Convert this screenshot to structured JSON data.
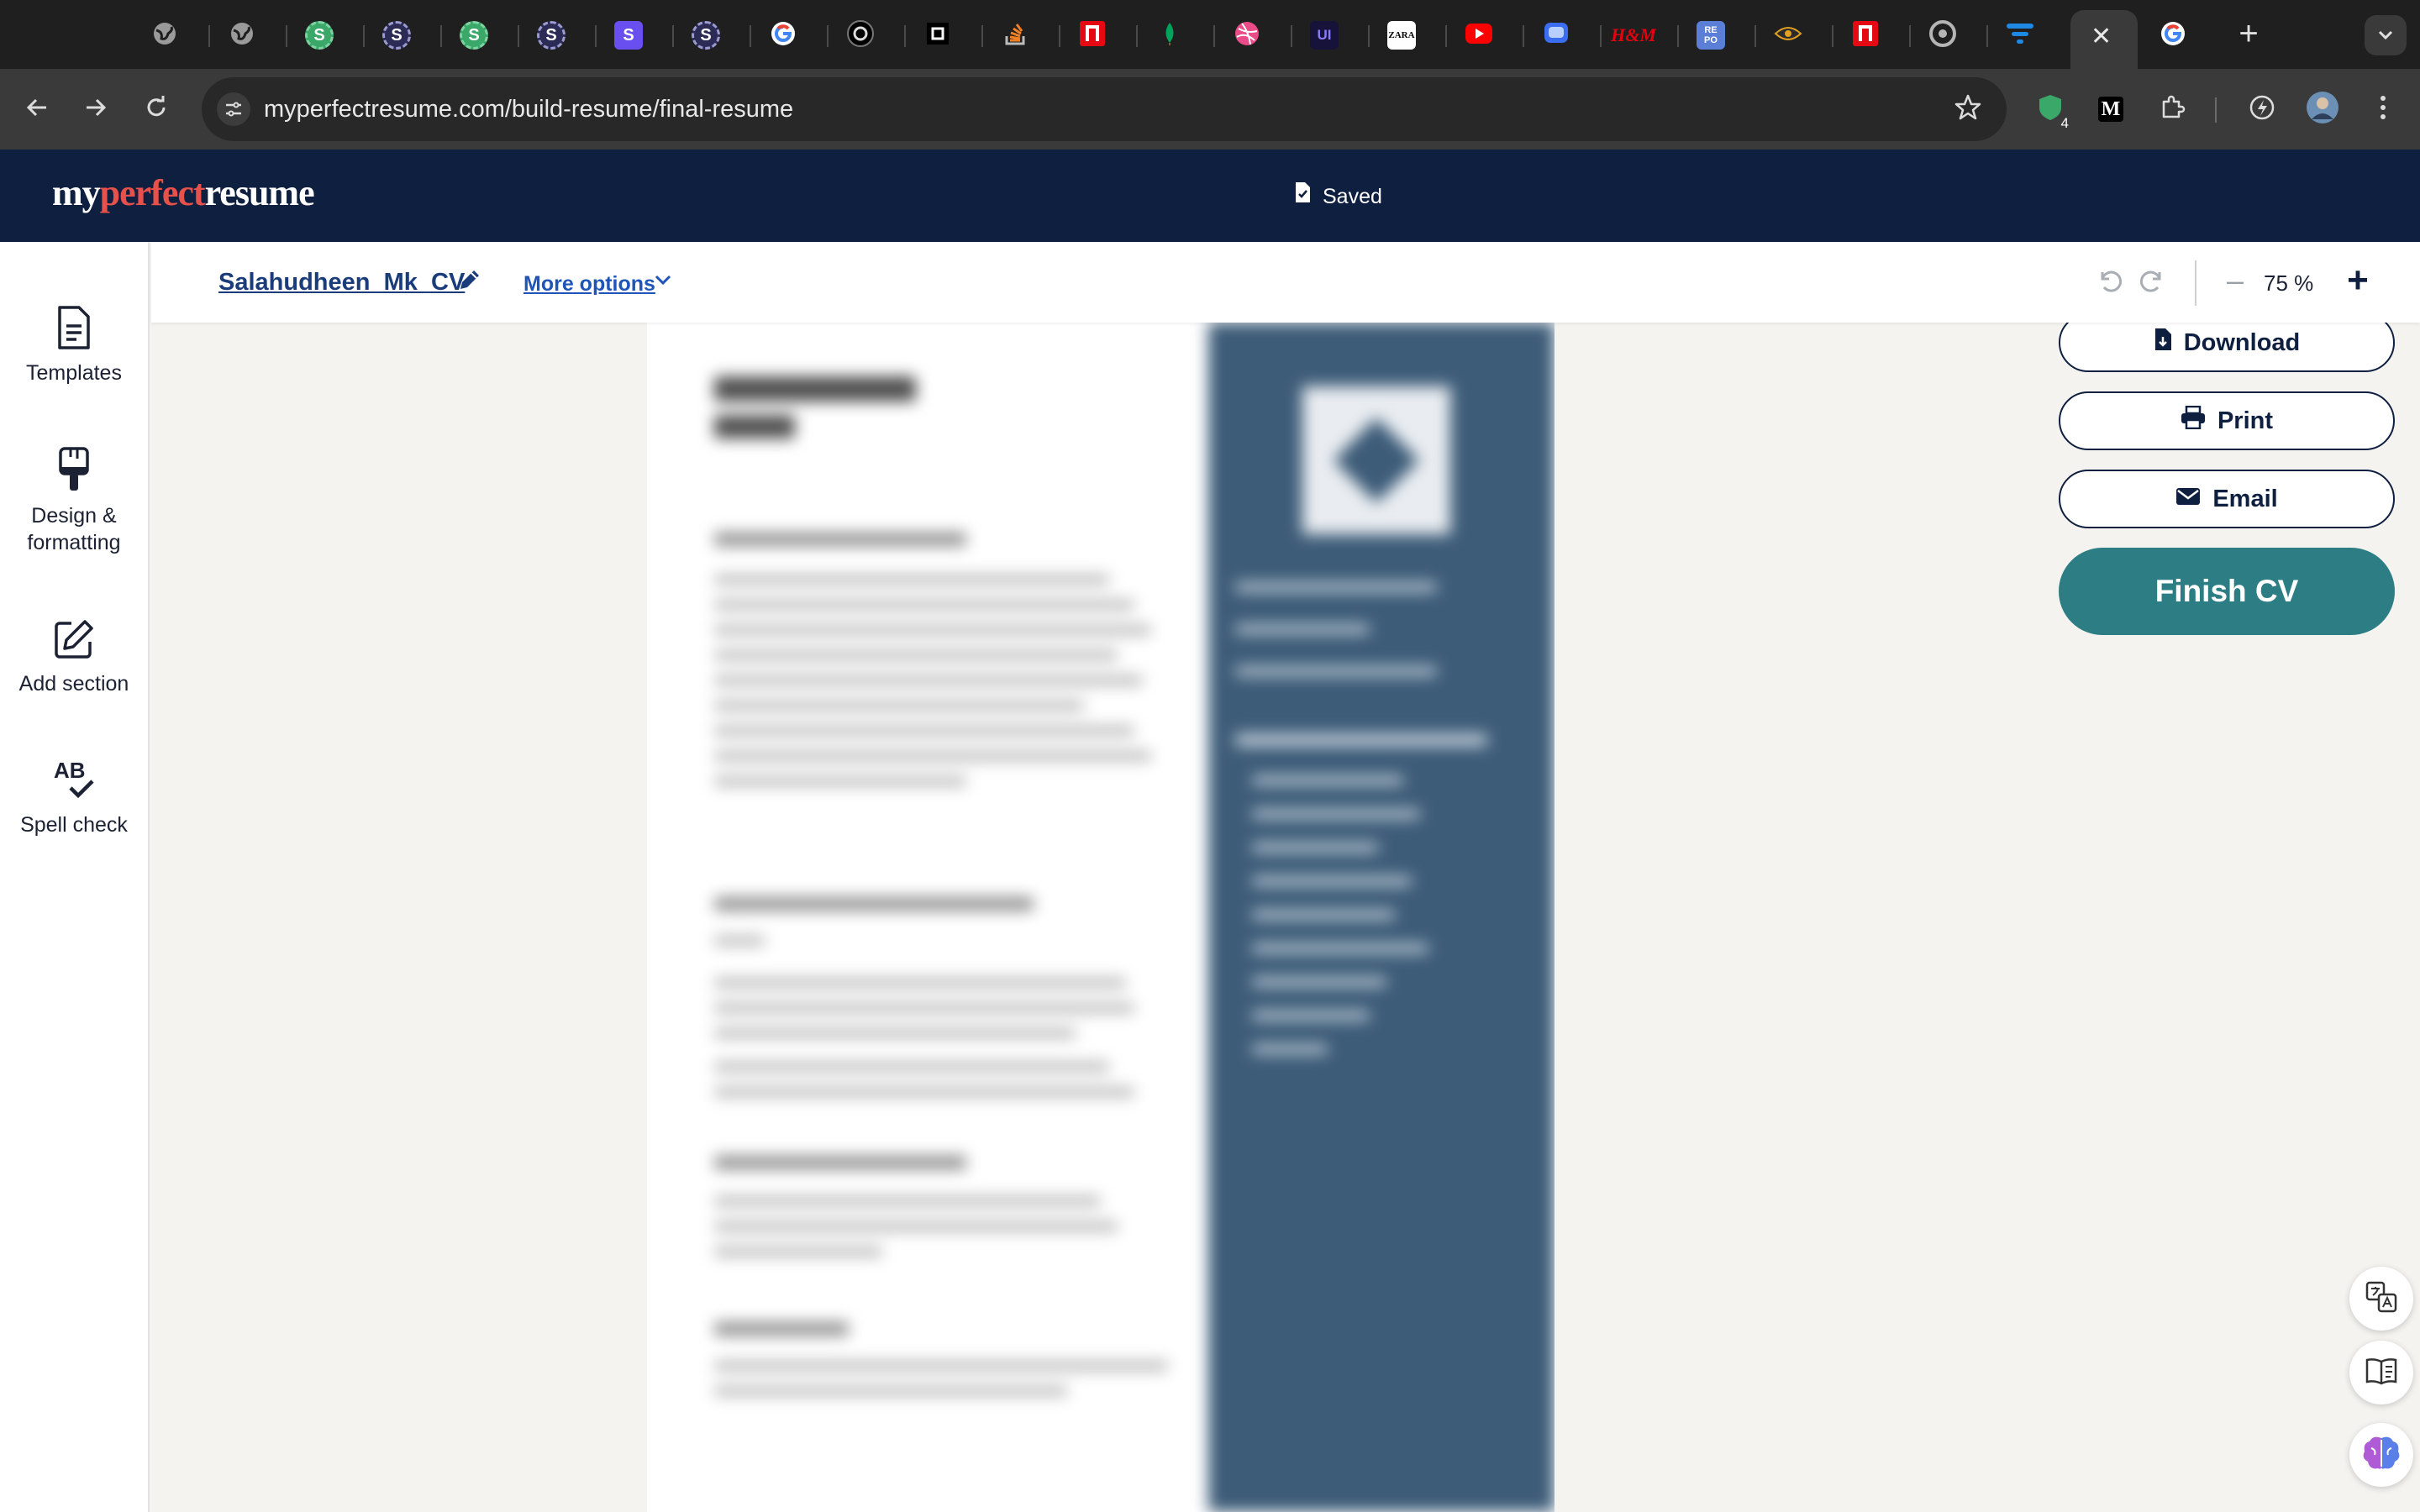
{
  "browser": {
    "url": "myperfectresume.com/build-resume/final-resume",
    "tab_favicons": [
      "globe-icon",
      "globe-icon",
      "s-green-icon",
      "s-dark-icon",
      "s-green-icon",
      "s-dark-icon",
      "s-purple-icon",
      "s-dark-icon",
      "google-icon",
      "openai-icon",
      "square-icon",
      "stackoverflow-icon",
      "netflix-icon",
      "leaf-icon",
      "dribbble-icon",
      "ui-icon",
      "zara-icon",
      "youtube-icon",
      "chat-icon",
      "hm-icon",
      "repo-icon",
      "eye-icon",
      "netflix-icon",
      "chrome-icon",
      "filter-icon"
    ],
    "tab_letters": {
      "s": "S",
      "ui": "UI",
      "zara": "ZARA",
      "hm": "H&M",
      "repo": "RE PO"
    },
    "extension_badge": "4",
    "extension_letter": "M"
  },
  "header": {
    "logo": {
      "part1": "my",
      "part2": "perfect",
      "part3": "resume"
    },
    "status": "Saved",
    "colors": {
      "navy": "#0f1f40",
      "accent": "#e8504a",
      "teal": "#2d7d85"
    }
  },
  "sidebar": {
    "items": [
      {
        "label": "Templates",
        "icon": "document-icon"
      },
      {
        "label": "Design & formatting",
        "icon": "paint-brush-icon"
      },
      {
        "label": "Add section",
        "icon": "edit-square-icon"
      },
      {
        "label": "Spell check",
        "icon": "spell-check-icon"
      }
    ],
    "spell_icon_text": "AB"
  },
  "doc_toolbar": {
    "doc_name": "Salahudheen_Mk_CV",
    "more_options": "More options",
    "zoom": "75 %"
  },
  "actions": {
    "download": "Download",
    "print": "Print",
    "email": "Email",
    "finish": "Finish CV"
  }
}
